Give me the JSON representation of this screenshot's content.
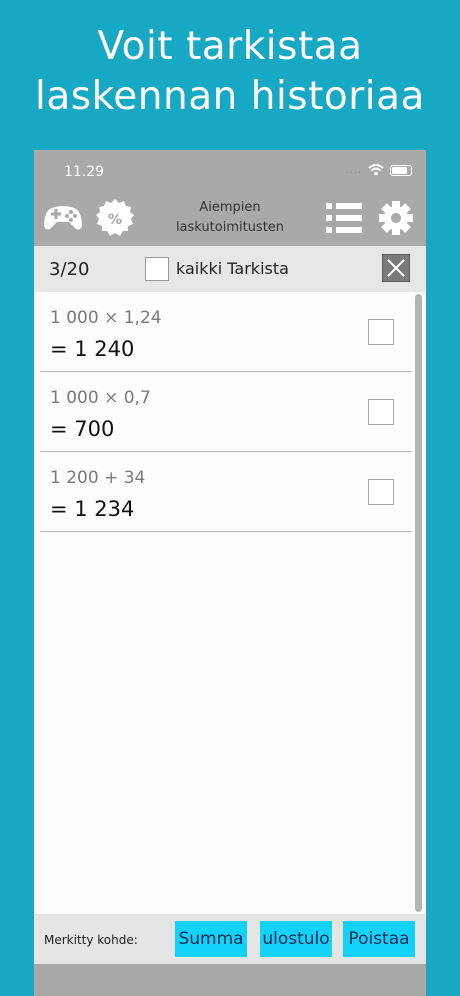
{
  "headline": {
    "line1": "Voit tarkistaa",
    "line2": "laskennan historiaa"
  },
  "status_bar": {
    "time": "11.29"
  },
  "toolbar": {
    "title_line1": "Aiempien",
    "title_line2": "laskutoimitusten"
  },
  "selection_bar": {
    "count": "3/20",
    "all_label": "kaikki Tarkista"
  },
  "history": [
    {
      "expression": "1 000 × 1,24",
      "result": "= 1 240"
    },
    {
      "expression": "1 000 × 0,7",
      "result": "= 700"
    },
    {
      "expression": "1 200 + 34",
      "result": "= 1 234"
    }
  ],
  "bottom_bar": {
    "marked_label": "Merkitty kohde:",
    "sum_button": "Summa",
    "output_button": "ulostulo",
    "delete_button": "Poistaa"
  },
  "colors": {
    "background": "#17a8c4",
    "toolbar": "#a9a9a9",
    "button": "#12d3f7"
  },
  "icons": [
    "gamepad-icon",
    "percent-badge-icon",
    "list-icon",
    "gear-icon",
    "wifi-icon",
    "battery-icon",
    "close-icon"
  ]
}
